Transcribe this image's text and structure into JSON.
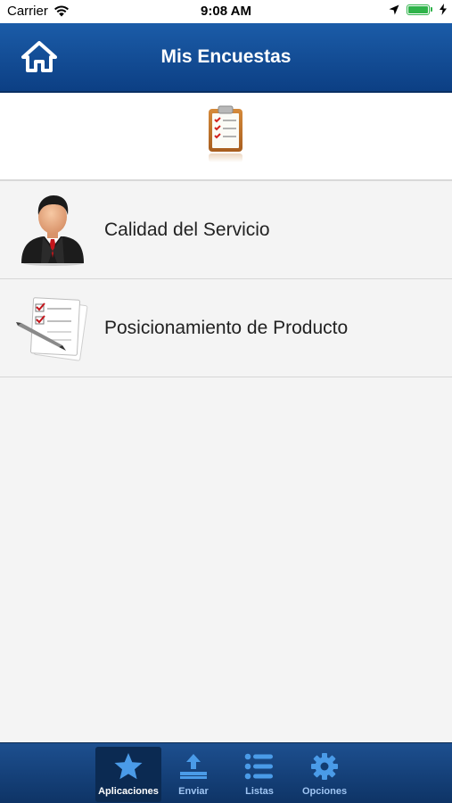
{
  "status_bar": {
    "carrier": "Carrier",
    "time": "9:08 AM"
  },
  "header": {
    "title": "Mis Encuestas"
  },
  "surveys": [
    {
      "label": "Calidad del Servicio",
      "icon": "businessman-icon"
    },
    {
      "label": "Posicionamiento de Producto",
      "icon": "checklist-document-icon"
    }
  ],
  "tab_bar": {
    "items": [
      {
        "label": "Aplicaciones",
        "icon": "star-icon",
        "active": true
      },
      {
        "label": "Enviar",
        "icon": "upload-tray-icon",
        "active": false
      },
      {
        "label": "Listas",
        "icon": "list-icon",
        "active": false
      },
      {
        "label": "Opciones",
        "icon": "gear-icon",
        "active": false
      }
    ]
  },
  "colors": {
    "nav_background": "#1b5ca8",
    "tab_background": "#1d4f8f",
    "tab_label_inactive": "#9fc5f3",
    "accent_icon": "#4a9be8",
    "battery": "#2fb34a"
  }
}
